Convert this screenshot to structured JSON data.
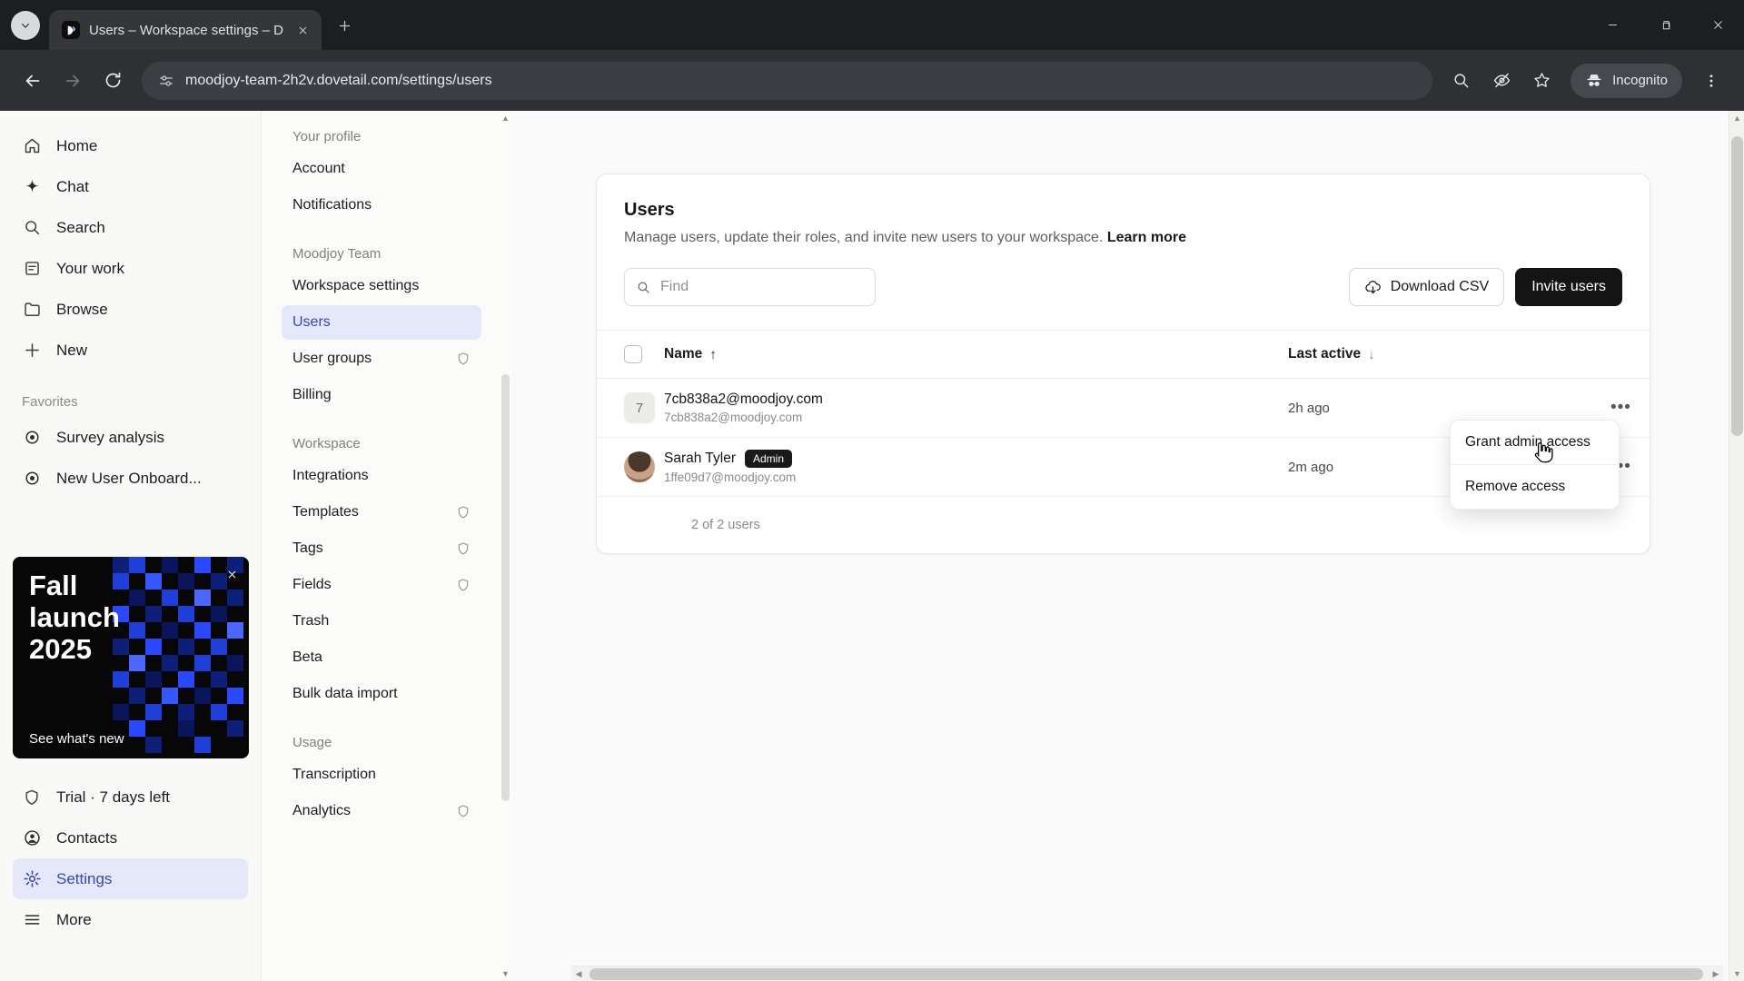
{
  "browser": {
    "tab_title": "Users – Workspace settings – D",
    "url": "moodjoy-team-2h2v.dovetail.com/settings/users",
    "incognito_label": "Incognito"
  },
  "colors": {
    "accent_blue": "#3847b6",
    "selected_bg": "#e4e8f9",
    "invite_button_bg": "#141414",
    "promo_blue": "#1f3fd8"
  },
  "sidebar": {
    "items": [
      {
        "label": "Home"
      },
      {
        "label": "Chat"
      },
      {
        "label": "Search"
      },
      {
        "label": "Your work"
      },
      {
        "label": "Browse"
      },
      {
        "label": "New"
      }
    ],
    "favorites_header": "Favorites",
    "favorites": [
      {
        "label": "Survey analysis"
      },
      {
        "label": "New User Onboard..."
      }
    ],
    "promo": {
      "title": "Fall launch 2025",
      "cta": "See what's new"
    },
    "trial": "Trial · 7 days left",
    "contacts": "Contacts",
    "settings": "Settings",
    "more": "More"
  },
  "settings_nav": {
    "sections": [
      {
        "header": "Your profile",
        "items": [
          {
            "label": "Account"
          },
          {
            "label": "Notifications"
          }
        ]
      },
      {
        "header": "Moodjoy Team",
        "items": [
          {
            "label": "Workspace settings"
          },
          {
            "label": "Users"
          },
          {
            "label": "User groups"
          },
          {
            "label": "Billing"
          }
        ]
      },
      {
        "header": "Workspace",
        "items": [
          {
            "label": "Integrations"
          },
          {
            "label": "Templates"
          },
          {
            "label": "Tags"
          },
          {
            "label": "Fields"
          },
          {
            "label": "Trash"
          },
          {
            "label": "Beta"
          },
          {
            "label": "Bulk data import"
          }
        ]
      },
      {
        "header": "Usage",
        "items": [
          {
            "label": "Transcription"
          },
          {
            "label": "Analytics"
          }
        ]
      }
    ]
  },
  "main": {
    "title": "Users",
    "description": "Manage users, update their roles, and invite new users to your workspace.",
    "learn_more": "Learn more",
    "find_placeholder": "Find",
    "download_csv_label": "Download CSV",
    "invite_users_label": "Invite users",
    "columns": {
      "name": "Name",
      "last_active": "Last active"
    },
    "rows": [
      {
        "avatar": "7",
        "name": "7cb838a2@moodjoy.com",
        "email": "7cb838a2@moodjoy.com",
        "last_active": "2h ago"
      },
      {
        "name": "Sarah Tyler",
        "badge": "Admin",
        "email": "1ffe09d7@moodjoy.com",
        "last_active": "2m ago"
      }
    ],
    "footer": "2 of 2 users",
    "menu": {
      "items": [
        {
          "label": "Grant admin access"
        },
        {
          "label": "Remove access"
        }
      ]
    }
  }
}
